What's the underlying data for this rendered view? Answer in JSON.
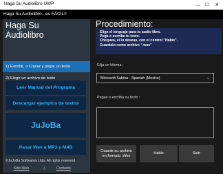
{
  "window": {
    "title": "Haga Su Audiolibro UWP",
    "minimize_glyph": "—",
    "maximize_glyph": "☐",
    "close_glyph": "✕"
  },
  "header": {
    "subtitle": "Haga Su Audiolibro...es FÁCIL!!"
  },
  "sidebar": {
    "title_line1": "Haga Su",
    "title_line2": "Audiolibro",
    "items": [
      {
        "label": "1) Escribir, o Copiar y pegar un texto"
      },
      {
        "label": "2) Elegir un archivo de texto"
      }
    ],
    "buttons": {
      "manual": "Leer Manual del Programa",
      "examples": "Descargar ejemplos de textos",
      "jujoba": "JuJoBa",
      "pasar": "Pasar Wav a MP3 y M4B"
    },
    "footer": "©JuJoBa Softwares Ltda. All rights reserved",
    "links": {
      "web": "Sitio Web",
      "separator": "|",
      "contact": "Contacto"
    }
  },
  "main": {
    "title": "Procedimiento:",
    "instructions": [
      "Elige el lenguaje para tu audio libro.",
      "Pega o escribe tu texto.",
      "Chequea, si lo deseas, con el control  \"Hable\".",
      "Guardalo como archivo \".wav\""
    ],
    "language_label": "Elija un Idioma:",
    "language_value": "Microsoft Sabina - Spanish (Mexico)",
    "text_label": "Pegue o escriba su texto :",
    "text_value": "",
    "buttons": {
      "save_line1": "Guarde su archivo",
      "save_line2": "en formato .Wav",
      "speak": "Hable",
      "exit": "Salir"
    }
  },
  "colors": {
    "sidebar_bg": "#2b3640",
    "active_item": "#1c6fb5",
    "instruction_box": "#1c2a55",
    "button_text": "#2fb0ef",
    "button_bg": "#0d2745"
  }
}
